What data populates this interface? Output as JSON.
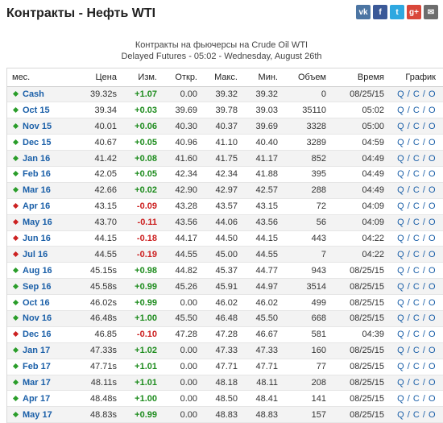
{
  "header": {
    "title": "Контракты - Нефть WTI",
    "subtitle_line1": "Контракты на фьючерсы на Crude Oil WTI",
    "subtitle_line2": "Delayed Futures - 05:02 - Wednesday, August 26th"
  },
  "social": [
    {
      "icon": "vk-icon",
      "glyph": "vk",
      "color": "#4c75a3"
    },
    {
      "icon": "facebook-icon",
      "glyph": "f",
      "color": "#3b5998"
    },
    {
      "icon": "twitter-icon",
      "glyph": "t",
      "color": "#2fa8e0"
    },
    {
      "icon": "googleplus-icon",
      "glyph": "g+",
      "color": "#d9473a"
    },
    {
      "icon": "email-icon",
      "glyph": "✉",
      "color": "#6d6d6d"
    }
  ],
  "columns": [
    "мес.",
    "Цена",
    "Изм.",
    "Откр.",
    "Макс.",
    "Мин.",
    "Объем",
    "Время",
    "График"
  ],
  "rows": [
    {
      "month": "Cash",
      "dir": "up",
      "price": "39.32s",
      "change": "+1.07",
      "open": "0.00",
      "high": "39.32",
      "low": "39.32",
      "volume": "0",
      "time": "08/25/15"
    },
    {
      "month": "Oct 15",
      "dir": "up",
      "price": "39.34",
      "change": "+0.03",
      "open": "39.69",
      "high": "39.78",
      "low": "39.03",
      "volume": "35110",
      "time": "05:02"
    },
    {
      "month": "Nov 15",
      "dir": "up",
      "price": "40.01",
      "change": "+0.06",
      "open": "40.30",
      "high": "40.37",
      "low": "39.69",
      "volume": "3328",
      "time": "05:00"
    },
    {
      "month": "Dec 15",
      "dir": "up",
      "price": "40.67",
      "change": "+0.05",
      "open": "40.96",
      "high": "41.10",
      "low": "40.40",
      "volume": "3289",
      "time": "04:59"
    },
    {
      "month": "Jan 16",
      "dir": "up",
      "price": "41.42",
      "change": "+0.08",
      "open": "41.60",
      "high": "41.75",
      "low": "41.17",
      "volume": "852",
      "time": "04:49"
    },
    {
      "month": "Feb 16",
      "dir": "up",
      "price": "42.05",
      "change": "+0.05",
      "open": "42.34",
      "high": "42.34",
      "low": "41.88",
      "volume": "395",
      "time": "04:49"
    },
    {
      "month": "Mar 16",
      "dir": "up",
      "price": "42.66",
      "change": "+0.02",
      "open": "42.90",
      "high": "42.97",
      "low": "42.57",
      "volume": "288",
      "time": "04:49"
    },
    {
      "month": "Apr 16",
      "dir": "down",
      "price": "43.15",
      "change": "-0.09",
      "open": "43.28",
      "high": "43.57",
      "low": "43.15",
      "volume": "72",
      "time": "04:09"
    },
    {
      "month": "May 16",
      "dir": "down",
      "price": "43.70",
      "change": "-0.11",
      "open": "43.56",
      "high": "44.06",
      "low": "43.56",
      "volume": "56",
      "time": "04:09"
    },
    {
      "month": "Jun 16",
      "dir": "down",
      "price": "44.15",
      "change": "-0.18",
      "open": "44.17",
      "high": "44.50",
      "low": "44.15",
      "volume": "443",
      "time": "04:22"
    },
    {
      "month": "Jul 16",
      "dir": "down",
      "price": "44.55",
      "change": "-0.19",
      "open": "44.55",
      "high": "45.00",
      "low": "44.55",
      "volume": "7",
      "time": "04:22"
    },
    {
      "month": "Aug 16",
      "dir": "up",
      "price": "45.15s",
      "change": "+0.98",
      "open": "44.82",
      "high": "45.37",
      "low": "44.77",
      "volume": "943",
      "time": "08/25/15"
    },
    {
      "month": "Sep 16",
      "dir": "up",
      "price": "45.58s",
      "change": "+0.99",
      "open": "45.26",
      "high": "45.91",
      "low": "44.97",
      "volume": "3514",
      "time": "08/25/15"
    },
    {
      "month": "Oct 16",
      "dir": "up",
      "price": "46.02s",
      "change": "+0.99",
      "open": "0.00",
      "high": "46.02",
      "low": "46.02",
      "volume": "499",
      "time": "08/25/15"
    },
    {
      "month": "Nov 16",
      "dir": "up",
      "price": "46.48s",
      "change": "+1.00",
      "open": "45.50",
      "high": "46.48",
      "low": "45.50",
      "volume": "668",
      "time": "08/25/15"
    },
    {
      "month": "Dec 16",
      "dir": "down",
      "price": "46.85",
      "change": "-0.10",
      "open": "47.28",
      "high": "47.28",
      "low": "46.67",
      "volume": "581",
      "time": "04:39"
    },
    {
      "month": "Jan 17",
      "dir": "up",
      "price": "47.33s",
      "change": "+1.02",
      "open": "0.00",
      "high": "47.33",
      "low": "47.33",
      "volume": "160",
      "time": "08/25/15"
    },
    {
      "month": "Feb 17",
      "dir": "up",
      "price": "47.71s",
      "change": "+1.01",
      "open": "0.00",
      "high": "47.71",
      "low": "47.71",
      "volume": "77",
      "time": "08/25/15"
    },
    {
      "month": "Mar 17",
      "dir": "up",
      "price": "48.11s",
      "change": "+1.01",
      "open": "0.00",
      "high": "48.18",
      "low": "48.11",
      "volume": "208",
      "time": "08/25/15"
    },
    {
      "month": "Apr 17",
      "dir": "up",
      "price": "48.48s",
      "change": "+1.00",
      "open": "0.00",
      "high": "48.50",
      "low": "48.41",
      "volume": "141",
      "time": "08/25/15"
    },
    {
      "month": "May 17",
      "dir": "up",
      "price": "48.83s",
      "change": "+0.99",
      "open": "0.00",
      "high": "48.83",
      "low": "48.83",
      "volume": "157",
      "time": "08/25/15"
    }
  ],
  "chart_links": {
    "q": "Q",
    "c": "C",
    "o": "O",
    "sep": " / "
  },
  "colors": {
    "link": "#1a5fa8",
    "positive": "#1e8c1e",
    "negative": "#cc1f1f"
  }
}
